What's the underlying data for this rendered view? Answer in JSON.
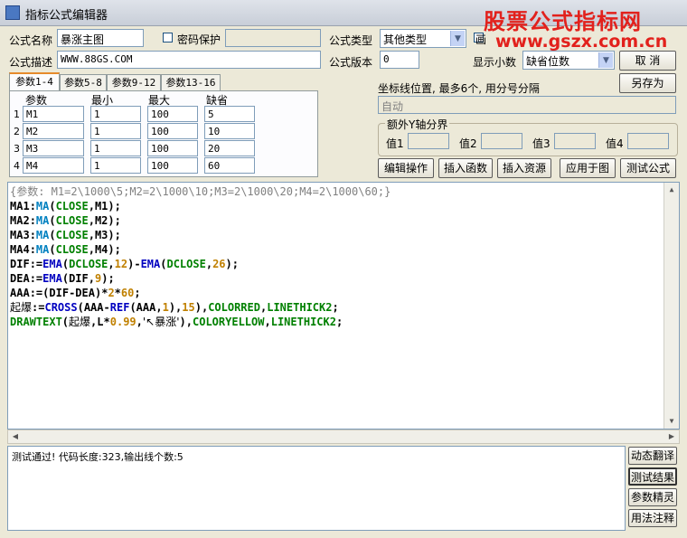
{
  "window": {
    "title": "指标公式编辑器"
  },
  "watermark": {
    "line1": "股票公式指标网",
    "line2": "www.gszx.com.cn"
  },
  "form": {
    "name_label": "公式名称",
    "name_value": "暴涨主图",
    "password_label": "密码保护",
    "desc_label": "公式描述",
    "desc_value": "WWW.88GS.COM",
    "type_label": "公式类型",
    "type_value": "其他类型",
    "draw_label": "画",
    "version_label": "公式版本",
    "version_value": "0",
    "decimals_label": "显示小数",
    "decimals_value": "缺省位数"
  },
  "buttons": {
    "cancel": "取 消",
    "save_as": "另存为",
    "edit_op": "编辑操作",
    "insert_func": "插入函数",
    "insert_res": "插入资源",
    "apply_chart": "应用于图",
    "test": "测试公式",
    "dyn_translate": "动态翻译",
    "test_result": "测试结果",
    "param_wizard": "参数精灵",
    "usage_notes": "用法注释"
  },
  "tabs": [
    "参数1-4",
    "参数5-8",
    "参数9-12",
    "参数13-16"
  ],
  "params": {
    "headers": [
      "参数",
      "最小",
      "最大",
      "缺省"
    ],
    "rows": [
      {
        "num": "1",
        "name": "M1",
        "min": "1",
        "max": "100",
        "def": "5"
      },
      {
        "num": "2",
        "name": "M2",
        "min": "1",
        "max": "100",
        "def": "10"
      },
      {
        "num": "3",
        "name": "M3",
        "min": "1",
        "max": "100",
        "def": "20"
      },
      {
        "num": "4",
        "name": "M4",
        "min": "1",
        "max": "100",
        "def": "60"
      }
    ]
  },
  "axis": {
    "label": "坐标线位置, 最多6个, 用分号分隔",
    "value": "自动",
    "group_label": "额外Y轴分界",
    "values": [
      "值1",
      "值2",
      "值3",
      "值4"
    ]
  },
  "code": {
    "l1": "{参数: M1=2\\1000\\5;M2=2\\1000\\10;M3=2\\1000\\20;M4=2\\1000\\60;}",
    "ma1": "MA1",
    "ma2": "MA2",
    "ma3": "MA3",
    "ma4": "MA4",
    "t_assign": ":",
    "t_ma": "MA",
    "t_close": "CLOSE",
    "t_dclose": "DCLOSE",
    "t_ema": "EMA",
    "t_dif": "DIF",
    "t_dea": "DEA",
    "t_aaa": "AAA",
    "t_cross": "CROSS",
    "t_ref": "REF",
    "t_colorred": "COLORRED",
    "t_coloryellow": "COLORYELLOW",
    "t_thick": "LINETHICK2",
    "t_drawtext": "DRAWTEXT",
    "t_qibao": "起爆",
    "t_low": "L",
    "t_bzstr": "'↖暴涨'",
    "n12": "12",
    "n26": "26",
    "n9": "9",
    "n2": "2",
    "n60": "60",
    "n1": "1",
    "n15": "15",
    "n099": "0.99"
  },
  "status": {
    "message": "测试通过! 代码长度:323,输出线个数:5"
  }
}
